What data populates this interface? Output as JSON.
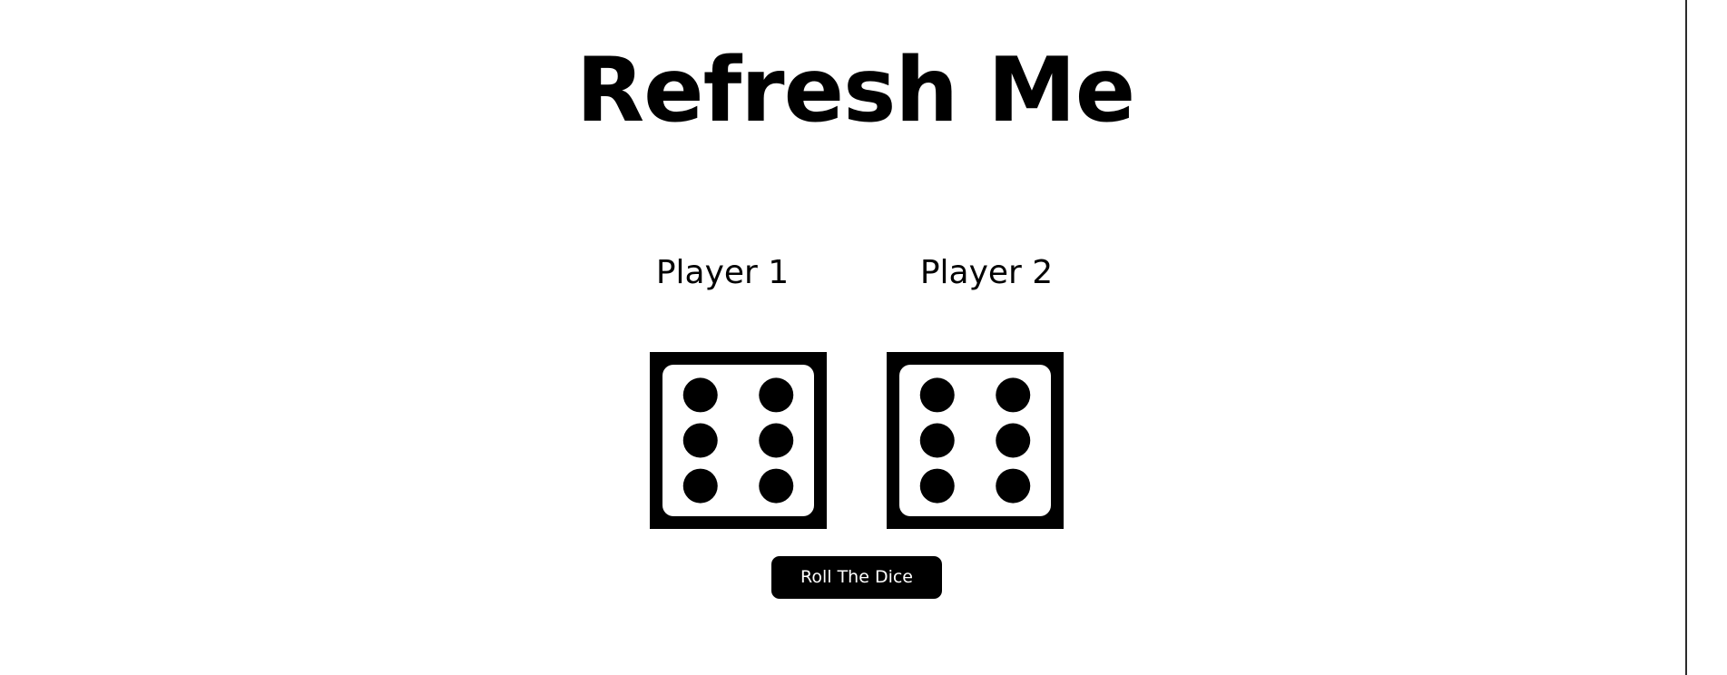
{
  "title": "Refresh Me",
  "players": [
    {
      "label": "Player 1",
      "die_value": 6
    },
    {
      "label": "Player 2",
      "die_value": 6
    }
  ],
  "roll_button_label": "Roll The Dice",
  "colors": {
    "background": "#ffffff",
    "text": "#000000",
    "die": "#000000",
    "button_bg": "#000000",
    "button_text": "#ffffff"
  },
  "icons": {
    "die": "die-six-icon"
  }
}
